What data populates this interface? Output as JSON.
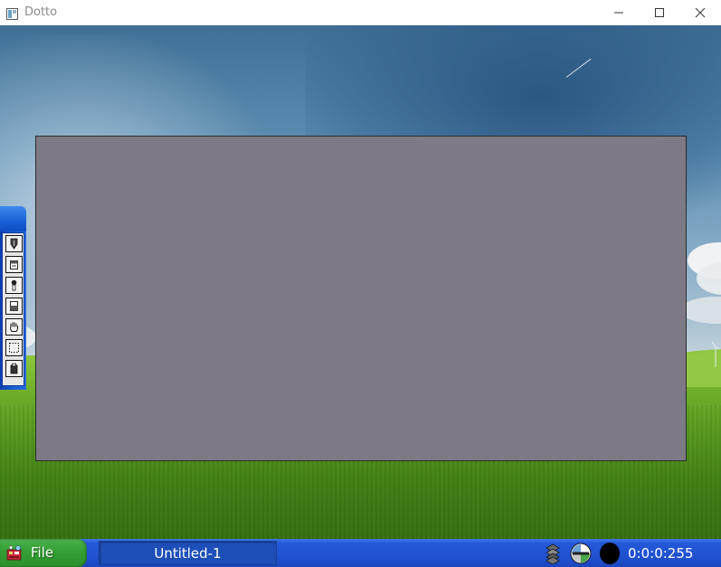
{
  "window": {
    "title": "Dotto"
  },
  "canvas": {
    "fill_color": "#7e7a85"
  },
  "palette": {
    "tools": [
      {
        "name": "pen-tool",
        "icon": "pen-icon"
      },
      {
        "name": "bucket-tool",
        "icon": "bucket-icon"
      },
      {
        "name": "dropper-tool",
        "icon": "dropper-icon"
      },
      {
        "name": "eraser-tool",
        "icon": "eraser-icon"
      },
      {
        "name": "hand-tool",
        "icon": "hand-icon"
      },
      {
        "name": "marquee-tool",
        "icon": "marquee-icon"
      },
      {
        "name": "paste-tool",
        "icon": "paste-icon"
      }
    ]
  },
  "taskbar": {
    "start_label": "File",
    "task_label": "Untitled-1",
    "clock": "0:0:0:255",
    "tray": {
      "layers_icon": "layers-icon",
      "mode_icon": "globe-icon",
      "color_icon": "color-swatch-icon",
      "color_value": "#000000"
    }
  },
  "colors": {
    "taskbar": "#2152d0",
    "start": "#34a034",
    "canvas": "#7e7a85"
  }
}
